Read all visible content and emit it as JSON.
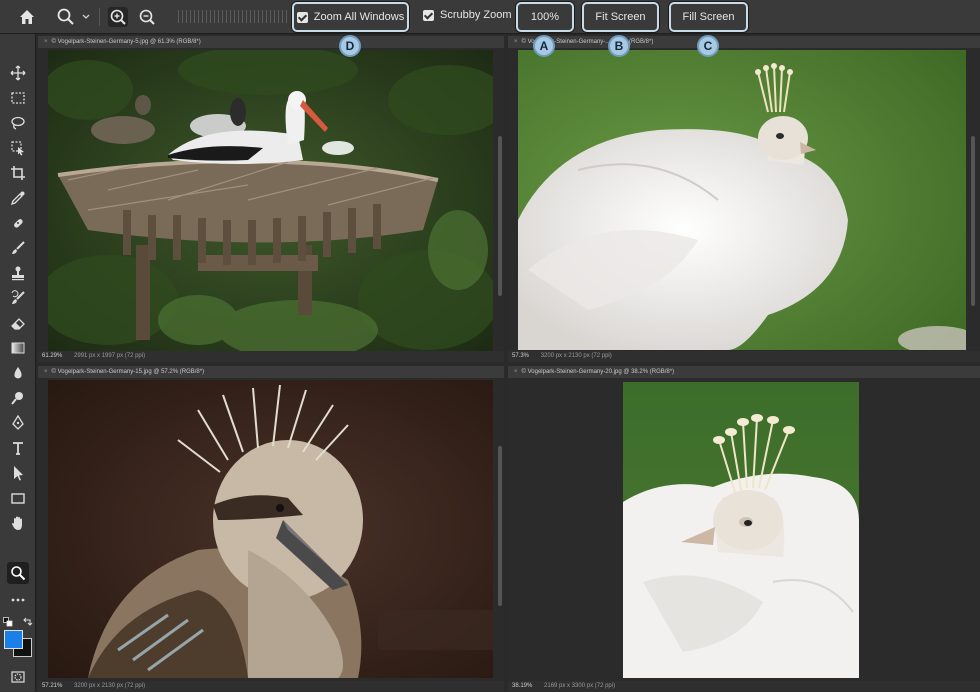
{
  "options_bar": {
    "zoom_all_windows_label": "Zoom All Windows",
    "scrubby_zoom_label": "Scrubby Zoom",
    "zoom_value": "100%",
    "fit_screen_label": "Fit Screen",
    "fill_screen_label": "Fill Screen"
  },
  "callouts": [
    "A",
    "B",
    "C",
    "D"
  ],
  "documents": [
    {
      "tab": "© Vogelpark-Steinen-Germany-5.jpg @ 61.3% (RGB/8*)",
      "zoom": "61.29%",
      "info": "2991 px x 1997 px (72 ppi)"
    },
    {
      "tab": "© Vogelpark-Steinen-Germany-...57.3% (RGB/8*)",
      "zoom": "57.3%",
      "info": "3200 px x 2130 px (72 ppi)"
    },
    {
      "tab": "© Vogelpark-Steinen-Germany-15.jpg @ 57.2% (RGB/8*)",
      "zoom": "57.21%",
      "info": "3200 px x 2130 px (72 ppi)"
    },
    {
      "tab": "© Vogelpark-Steinen-Germany-20.jpg @ 38.2% (RGB/8*)",
      "zoom": "38.19%",
      "info": "2169 px x 3300 px (72 ppi)"
    }
  ],
  "colors": {
    "accent": "#c8dbe8",
    "badge": "#a9c9e3",
    "foreground_swatch": "#1a7fe6",
    "background_swatch": "#111111"
  }
}
